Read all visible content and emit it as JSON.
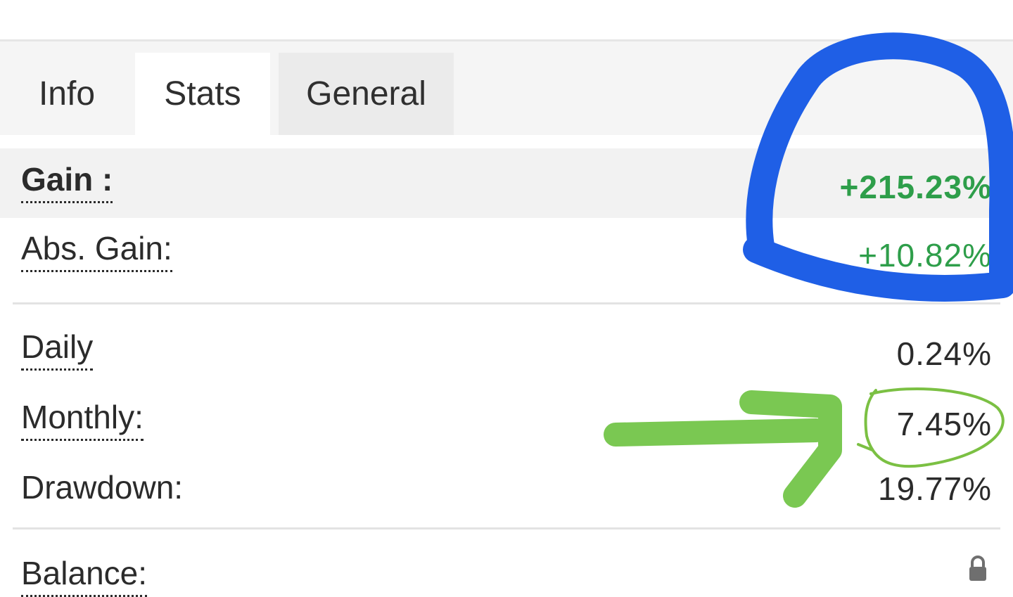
{
  "tabs": [
    {
      "label": "Info"
    },
    {
      "label": "Stats"
    },
    {
      "label": "General"
    }
  ],
  "active_tab": "Stats",
  "stats": {
    "gain": {
      "label": "Gain :",
      "value": "+215.23%"
    },
    "abs_gain": {
      "label": "Abs. Gain:",
      "value": "+10.82%"
    },
    "daily": {
      "label": "Daily",
      "value": "0.24%"
    },
    "monthly": {
      "label": "Monthly:",
      "value": "7.45%"
    },
    "drawdown": {
      "label": "Drawdown:",
      "value": "19.77%"
    },
    "balance": {
      "label": "Balance:"
    }
  },
  "icons": {
    "balance_lock": "lock-icon"
  },
  "colors": {
    "positive": "#2e9e4a",
    "annotation_blue": "#1f5fe6",
    "annotation_green": "#6cc23f",
    "row_highlight": "#f2f2f2"
  }
}
